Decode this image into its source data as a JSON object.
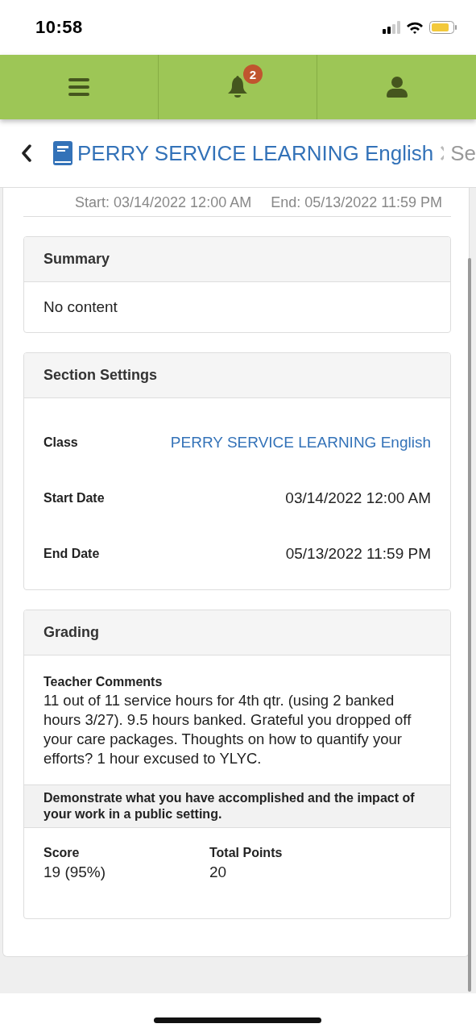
{
  "status_bar": {
    "time": "10:58"
  },
  "nav": {
    "notification_count": "2"
  },
  "breadcrumb": [
    {
      "label": "PERRY SERVICE LEARNING English",
      "kind": "link"
    },
    {
      "label": "Se",
      "kind": "current"
    }
  ],
  "section_dates": {
    "start": "Start: 03/14/2022 12:00 AM",
    "end": "End: 05/13/2022 11:59 PM"
  },
  "summary": {
    "title": "Summary",
    "text": "No content"
  },
  "settings": {
    "title": "Section Settings",
    "rows": [
      {
        "label": "Class",
        "value": "PERRY SERVICE LEARNING English",
        "kind": "link"
      },
      {
        "label": "Start Date",
        "value": "03/14/2022 12:00 AM",
        "kind": "text"
      },
      {
        "label": "End Date",
        "value": "05/13/2022 11:59 PM",
        "kind": "text"
      }
    ]
  },
  "grading": {
    "title": "Grading",
    "comments_label": "Teacher Comments",
    "comments": "11 out of 11 service hours for 4th qtr. (using 2 banked hours 3/27). 9.5 hours banked. Grateful you dropped off your care packages. Thoughts on how to quantify your efforts? 1 hour excused to YLYC.",
    "criterion": "Demonstrate what you have accomplished and the impact of your work in a public setting.",
    "score_label": "Score",
    "score": "19 (95%)",
    "total_label": "Total Points",
    "total": "20"
  }
}
